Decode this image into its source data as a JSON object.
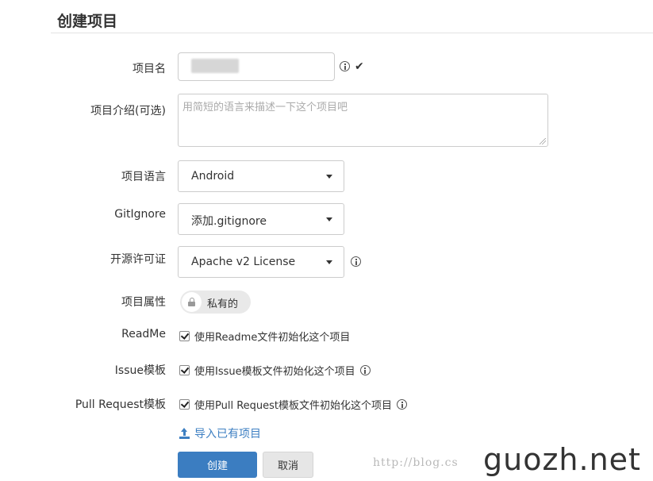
{
  "page": {
    "title": "创建项目"
  },
  "form": {
    "name": {
      "label": "项目名",
      "value": ""
    },
    "description": {
      "label": "项目介绍(可选)",
      "placeholder": "用简短的语言来描述一下这个项目吧"
    },
    "language": {
      "label": "项目语言",
      "selected": "Android"
    },
    "gitignore": {
      "label": "GitIgnore",
      "selected": "添加.gitignore"
    },
    "license": {
      "label": "开源许可证",
      "selected": "Apache v2 License"
    },
    "visibility": {
      "label": "项目属性",
      "value": "私有的"
    },
    "readme": {
      "label": "ReadMe",
      "checkbox_label": "使用Readme文件初始化这个项目",
      "checked": true
    },
    "issue_template": {
      "label": "Issue模板",
      "checkbox_label": "使用Issue模板文件初始化这个项目",
      "checked": true
    },
    "pr_template": {
      "label": "Pull Request模板",
      "checkbox_label": "使用Pull Request模板文件初始化这个项目",
      "checked": true
    },
    "import_link": "导入已有项目",
    "create_button": "创建",
    "cancel_button": "取消"
  },
  "watermark": {
    "url": "http://blog.cs",
    "logo": "guozh.net"
  },
  "colors": {
    "primary": "#3b7dc1",
    "link": "#3d7fc2",
    "border": "#cccccc"
  }
}
